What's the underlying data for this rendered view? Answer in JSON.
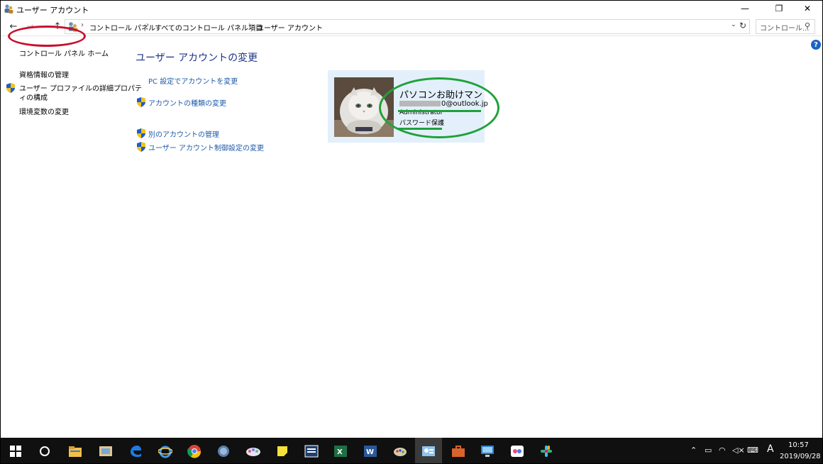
{
  "window": {
    "title": "ユーザー アカウント",
    "min_glyph": "—",
    "max_glyph": "❐",
    "close_glyph": "✕"
  },
  "address": {
    "crumbs": [
      "コントロール パネル",
      "すべてのコントロール パネル項目",
      "ユーザー アカウント"
    ],
    "search_placeholder": "コントロール...",
    "icons": [
      "back-arrow-icon",
      "forward-arrow-icon",
      "chevron-down-icon",
      "up-arrow-icon",
      "refresh-icon",
      "search-icon"
    ]
  },
  "left_pane": {
    "home": "コントロール パネル ホーム",
    "credentials": "資格情報の管理",
    "profile_line1": "ユーザー プロファイルの詳細プロパテ",
    "profile_line2": "ィの構成",
    "env_vars": "環境変数の変更"
  },
  "main": {
    "title": "ユーザー アカウントの変更",
    "tasks": {
      "pc_settings": "PC 設定でアカウントを変更",
      "change_type": "アカウントの種類の変更",
      "manage_other": "別のアカウントの管理",
      "uac_settings": "ユーザー アカウント制御設定の変更"
    }
  },
  "account": {
    "name": "パソコンお助けマン",
    "email_visible": "0@outlook.jp",
    "role": "Administrator",
    "password_status": "パスワード保護"
  },
  "annotations": {
    "red_circle_color": "#c8102e",
    "green_circle_color": "#1fa13a"
  },
  "taskbar": {
    "clock_time": "10:57",
    "clock_date": "2019/09/28",
    "ime_indicator": "A",
    "apps": [
      "windows-start-icon",
      "cortana-icon",
      "file-explorer-icon",
      "photos-icon",
      "edge-icon",
      "internet-explorer-icon",
      "chrome-icon",
      "app-icon",
      "paint-icon",
      "sticky-notes-icon",
      "app-icon",
      "excel-icon",
      "word-icon",
      "paint-icon",
      "user-accounts-icon",
      "toolbox-icon",
      "remote-desktop-icon",
      "app-icon",
      "slack-icon"
    ]
  }
}
